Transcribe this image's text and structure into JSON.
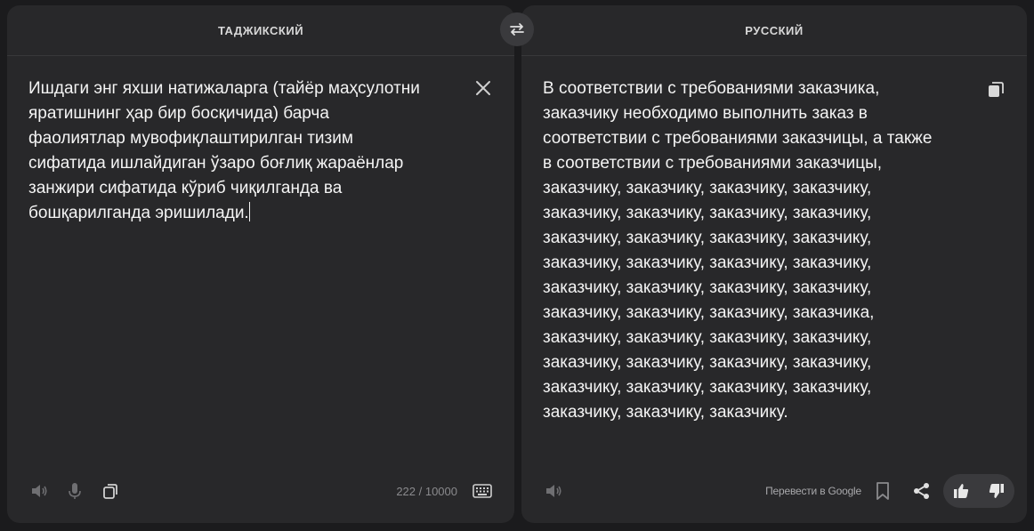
{
  "source": {
    "language": "ТАДЖИКСКИЙ",
    "text": "Ишдаги энг яхши натижаларга (тайёр маҳсулотни\nяратишнинг ҳар бир босқичида) барча\nфаолиятлар мувофиқлаштирилган тизим\nсифатида ишлайдиган ўзаро боғлиқ жараёнлар\nзанжири сифатида кўриб чиқилганда ва\nбошқарилганда эришилади.",
    "counter": "222 / 10000"
  },
  "target": {
    "language": "РУССКИЙ",
    "text": "В соответствии с требованиями заказчика,\nзаказчику необходимо выполнить заказ в\nсоответствии с требованиями заказчицы, а также\nв соответствии с требованиями заказчицы,\nзаказчику, заказчику, заказчику, заказчику,\nзаказчику, заказчику, заказчику, заказчику,\nзаказчику, заказчику, заказчику, заказчику,\nзаказчику, заказчику, заказчику, заказчику,\nзаказчику, заказчику, заказчику, заказчику,\nзаказчику, заказчику, заказчику, заказчика,\nзаказчику, заказчику, заказчику, заказчику,\nзаказчику, заказчику, заказчику, заказчику,\nзаказчику, заказчику, заказчику, заказчику,\nзаказчику, заказчику, заказчику.",
    "google_link": "Перевести в Google"
  },
  "icons": {
    "swap": "swap-icon",
    "clear": "close-icon",
    "speaker": "speaker-icon",
    "mic": "microphone-icon",
    "copy": "copy-icon",
    "keyboard": "keyboard-icon",
    "bookmark": "bookmark-icon",
    "share": "share-icon",
    "like": "thumbs-up-icon",
    "dislike": "thumbs-down-icon"
  },
  "colors": {
    "background": "#1b1b1d",
    "panel": "#28282a",
    "text": "#f4f4f4",
    "muted": "#8a8a8d"
  }
}
